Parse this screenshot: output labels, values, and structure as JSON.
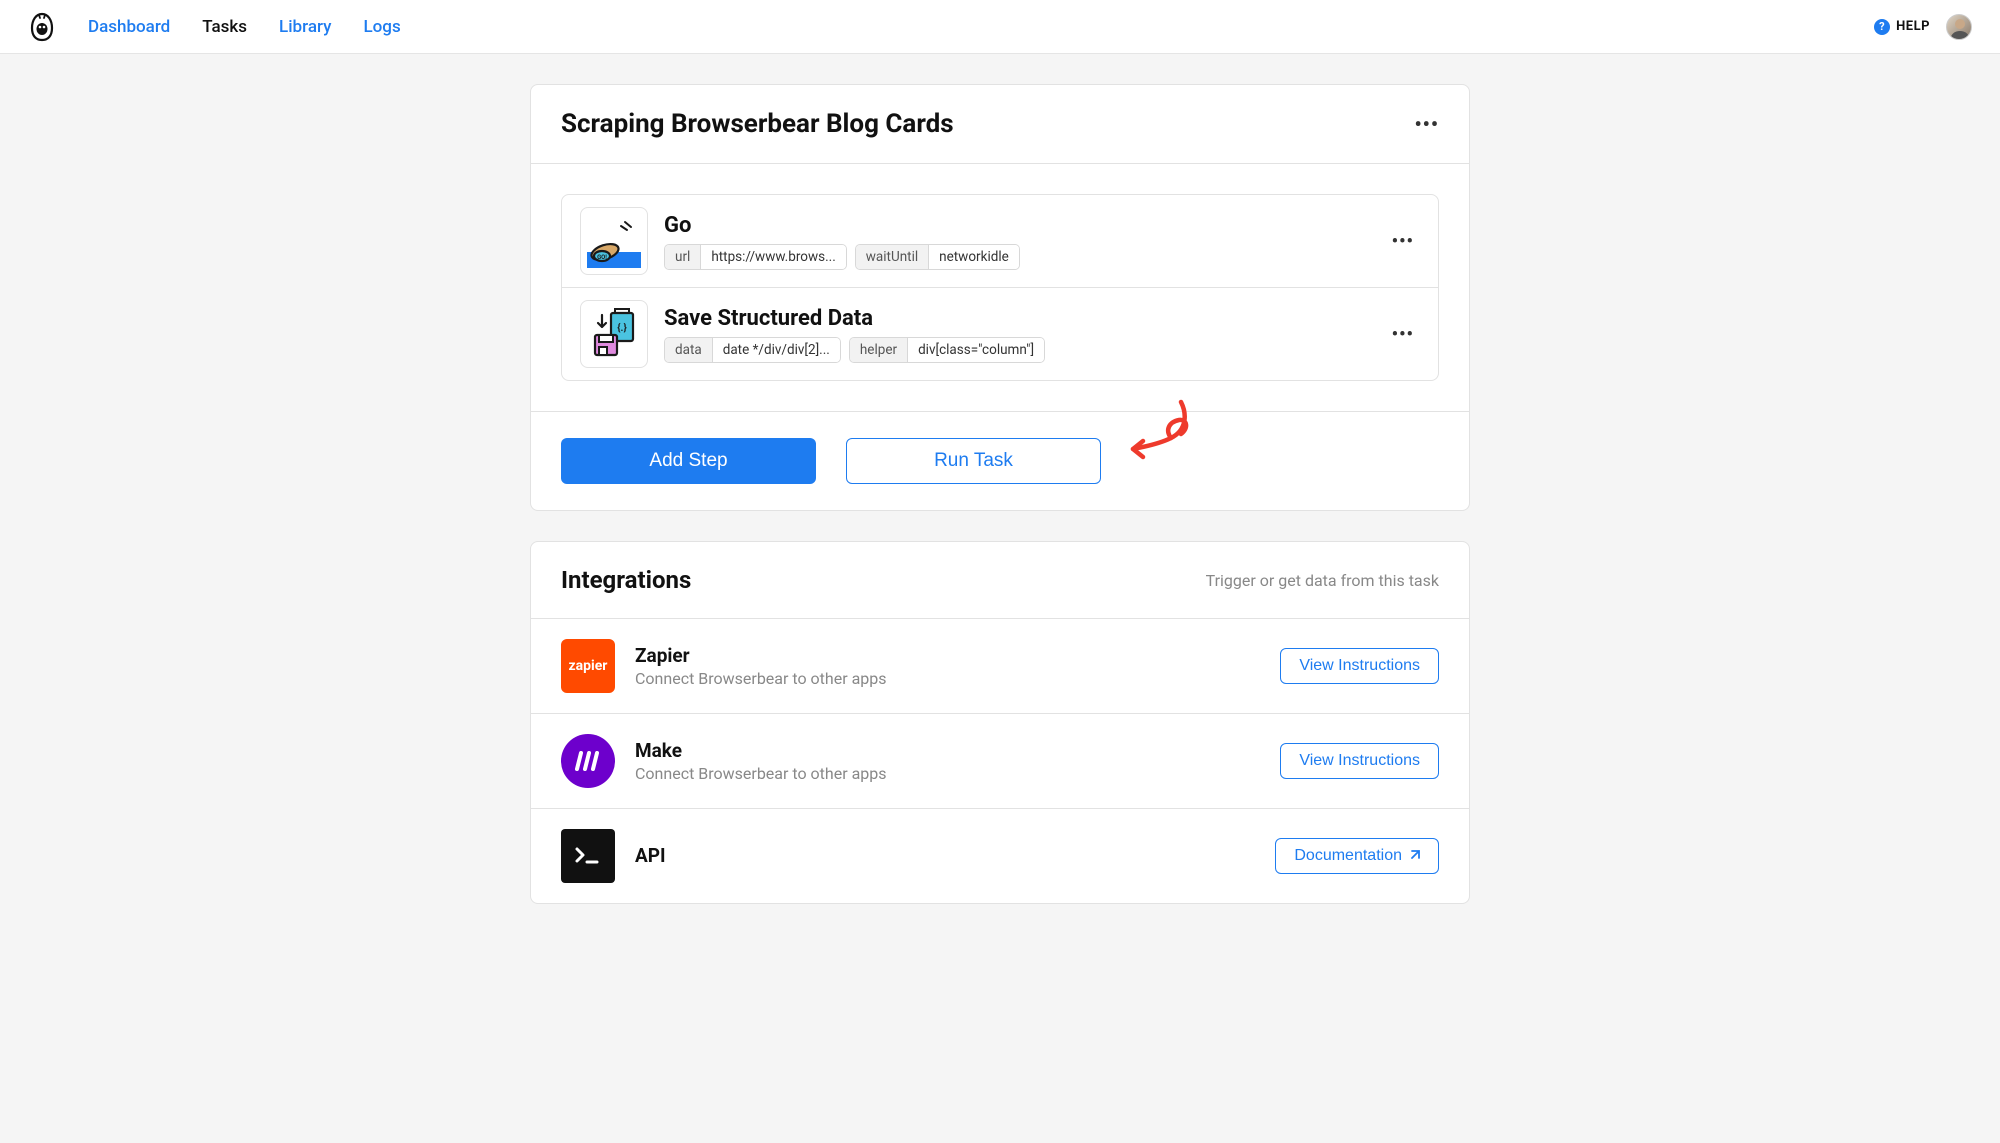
{
  "nav": {
    "links": [
      {
        "label": "Dashboard",
        "active": false
      },
      {
        "label": "Tasks",
        "active": true
      },
      {
        "label": "Library",
        "active": false
      },
      {
        "label": "Logs",
        "active": false
      }
    ],
    "help_label": "HELP"
  },
  "task": {
    "title": "Scraping Browserbear Blog Cards",
    "steps": [
      {
        "title": "Go",
        "tags": [
          {
            "key": "url",
            "val": "https://www.brows..."
          },
          {
            "key": "waitUntil",
            "val": "networkidle"
          }
        ]
      },
      {
        "title": "Save Structured Data",
        "tags": [
          {
            "key": "data",
            "val": "date */div/div[2]..."
          },
          {
            "key": "helper",
            "val": "div[class=\"column\"]"
          }
        ]
      }
    ],
    "add_step_label": "Add Step",
    "run_task_label": "Run Task"
  },
  "integrations": {
    "title": "Integrations",
    "subtitle": "Trigger or get data from this task",
    "items": [
      {
        "name": "Zapier",
        "desc": "Connect Browserbear to other apps",
        "action": "View Instructions",
        "icon": "zapier",
        "color": "#ff4a00"
      },
      {
        "name": "Make",
        "desc": "Connect Browserbear to other apps",
        "action": "View Instructions",
        "icon": "make",
        "color": "#6d00cc"
      },
      {
        "name": "API",
        "desc": "",
        "action": "Documentation",
        "icon": "api",
        "color": "#111"
      }
    ]
  }
}
